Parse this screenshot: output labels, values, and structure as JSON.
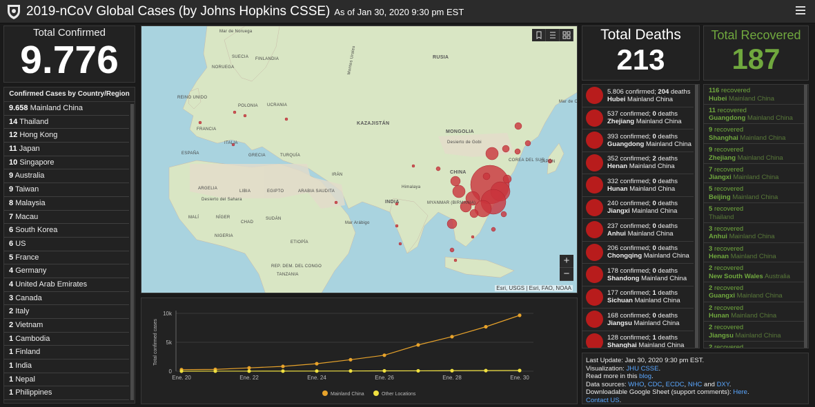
{
  "header": {
    "title": "2019-nCoV Global Cases (by Johns Hopkins CSSE)",
    "subtitle": "As of Jan 30, 2020 9:30 pm EST"
  },
  "total_confirmed": {
    "label": "Total Confirmed",
    "value": "9.776"
  },
  "countries": {
    "header": "Confirmed Cases by Country/Region",
    "items": [
      {
        "count": "9.658",
        "name": "Mainland China"
      },
      {
        "count": "14",
        "name": "Thailand"
      },
      {
        "count": "12",
        "name": "Hong Kong"
      },
      {
        "count": "11",
        "name": "Japan"
      },
      {
        "count": "10",
        "name": "Singapore"
      },
      {
        "count": "9",
        "name": "Australia"
      },
      {
        "count": "9",
        "name": "Taiwan"
      },
      {
        "count": "8",
        "name": "Malaysia"
      },
      {
        "count": "7",
        "name": "Macau"
      },
      {
        "count": "6",
        "name": "South Korea"
      },
      {
        "count": "6",
        "name": "US"
      },
      {
        "count": "5",
        "name": "France"
      },
      {
        "count": "4",
        "name": "Germany"
      },
      {
        "count": "4",
        "name": "United Arab Emirates"
      },
      {
        "count": "3",
        "name": "Canada"
      },
      {
        "count": "2",
        "name": "Italy"
      },
      {
        "count": "2",
        "name": "Vietnam"
      },
      {
        "count": "1",
        "name": "Cambodia"
      },
      {
        "count": "1",
        "name": "Finland"
      },
      {
        "count": "1",
        "name": "India"
      },
      {
        "count": "1",
        "name": "Nepal"
      },
      {
        "count": "1",
        "name": "Philippines"
      }
    ]
  },
  "map": {
    "attribution": "Esri, USGS | Esri, FAO, NOAA",
    "zoom_in": "+",
    "zoom_out": "−",
    "labels": [
      "Mar de Noruega",
      "SUECIA",
      "FINLANDIA",
      "NORUEGA",
      "RUSIA",
      "Montes Urales",
      "Mar de Ojotsk",
      "REINO UNIDO",
      "POLONIA",
      "UCRANIA",
      "KAZAJISTÁN",
      "FRANCIA",
      "ITALIA",
      "MONGOLIA",
      "Desierto de Gobi",
      "ESPAÑA",
      "GRECIA",
      "TURQUÍA",
      "COREA DEL SUR",
      "JAPÓN",
      "CHINA",
      "IRÁN",
      "Himalaya",
      "ARGELIA",
      "LIBIA",
      "EGIPTO",
      "ARABIA SAUDITA",
      "INDIA",
      "MYANMAR (BIRMANIA)",
      "Desierto del Sahara",
      "MALÍ",
      "NÍGER",
      "CHAD",
      "SUDÁN",
      "Mar Arábigo",
      "NIGERIA",
      "ETIOPÍA",
      "REP. DEM. DEL CONGO",
      "TANZANIA"
    ]
  },
  "total_deaths": {
    "label": "Total Deaths",
    "value": "213"
  },
  "total_recovered": {
    "label": "Total Recovered",
    "value": "187"
  },
  "deaths_list": [
    {
      "confirmed": "5.806",
      "deaths": "204",
      "province": "Hubei",
      "country": "Mainland China"
    },
    {
      "confirmed": "537",
      "deaths": "0",
      "province": "Zhejiang",
      "country": "Mainland China"
    },
    {
      "confirmed": "393",
      "deaths": "0",
      "province": "Guangdong",
      "country": "Mainland China"
    },
    {
      "confirmed": "352",
      "deaths": "2",
      "province": "Henan",
      "country": "Mainland China"
    },
    {
      "confirmed": "332",
      "deaths": "0",
      "province": "Hunan",
      "country": "Mainland China"
    },
    {
      "confirmed": "240",
      "deaths": "0",
      "province": "Jiangxi",
      "country": "Mainland China"
    },
    {
      "confirmed": "237",
      "deaths": "0",
      "province": "Anhui",
      "country": "Mainland China"
    },
    {
      "confirmed": "206",
      "deaths": "0",
      "province": "Chongqing",
      "country": "Mainland China"
    },
    {
      "confirmed": "178",
      "deaths": "0",
      "province": "Shandong",
      "country": "Mainland China"
    },
    {
      "confirmed": "177",
      "deaths": "1",
      "province": "Sichuan",
      "country": "Mainland China"
    },
    {
      "confirmed": "168",
      "deaths": "0",
      "province": "Jiangsu",
      "country": "Mainland China"
    },
    {
      "confirmed": "128",
      "deaths": "1",
      "province": "Shanghai",
      "country": "Mainland China"
    }
  ],
  "recovered_list": [
    {
      "count": "116",
      "province": "Hubei",
      "country": "Mainland China"
    },
    {
      "count": "11",
      "province": "Guangdong",
      "country": "Mainland China"
    },
    {
      "count": "9",
      "province": "Shanghai",
      "country": "Mainland China"
    },
    {
      "count": "9",
      "province": "Zhejiang",
      "country": "Mainland China"
    },
    {
      "count": "7",
      "province": "Jiangxi",
      "country": "Mainland China"
    },
    {
      "count": "5",
      "province": "Beijing",
      "country": "Mainland China"
    },
    {
      "count": "5",
      "province": "",
      "country": "Thailand"
    },
    {
      "count": "3",
      "province": "Anhui",
      "country": "Mainland China"
    },
    {
      "count": "3",
      "province": "Henan",
      "country": "Mainland China"
    },
    {
      "count": "2",
      "province": "New South Wales",
      "country": "Australia"
    },
    {
      "count": "2",
      "province": "Guangxi",
      "country": "Mainland China"
    },
    {
      "count": "2",
      "province": "Hunan",
      "country": "Mainland China"
    },
    {
      "count": "2",
      "province": "Jiangsu",
      "country": "Mainland China"
    },
    {
      "count": "2",
      "province": "",
      "country": ""
    }
  ],
  "recovered_word": "recovered",
  "info": {
    "last_update": "Last Update: Jan 30, 2020 9:30 pm EST.",
    "viz_pre": "Visualization: ",
    "viz_link": "JHU CSSE",
    "viz_post": ".",
    "read_pre": "Read more in this ",
    "read_link": "blog",
    "read_post": ".",
    "src_pre": "Data sources: ",
    "src1": "WHO",
    "src2": "CDC",
    "src3": "ECDC",
    "src4": "NHC",
    "src_and": " and ",
    "src5": "DXY",
    "src_post": ".",
    "sheet_pre": "Downloadable Google Sheet (support comments): ",
    "sheet_link": "Here",
    "sheet_post": ".",
    "contact_link": "Contact US",
    "contact_post": "."
  },
  "chart_data": {
    "type": "line",
    "ylabel": "Total confirmed cases",
    "xlabel": "",
    "ylim": [
      0,
      10000
    ],
    "yticks": [
      "0",
      "5k",
      "10k"
    ],
    "x": [
      "Ene. 20",
      "Ene. 21",
      "Ene. 22",
      "Ene. 23",
      "Ene. 24",
      "Ene. 25",
      "Ene. 26",
      "Ene. 27",
      "Ene. 28",
      "Ene. 29",
      "Ene. 30"
    ],
    "xtick_labels": [
      "Ene. 20",
      "Ene. 22",
      "Ene. 24",
      "Ene. 26",
      "Ene. 28",
      "Ene. 30"
    ],
    "series": [
      {
        "name": "Mainland China",
        "color": "#e8a32b",
        "values": [
          278,
          309,
          571,
          830,
          1297,
          1985,
          2761,
          4537,
          5970,
          7678,
          9658
        ]
      },
      {
        "name": "Other Locations",
        "color": "#f0e040",
        "values": [
          4,
          7,
          9,
          14,
          25,
          40,
          57,
          64,
          87,
          105,
          118
        ]
      }
    ]
  },
  "colors": {
    "bg": "#1a1a1a",
    "panel": "#222222",
    "deaths_dot": "#b81c1c",
    "recovered": "#70a83e",
    "link": "#5aa7ff",
    "map_bubble": "#c9343c"
  }
}
